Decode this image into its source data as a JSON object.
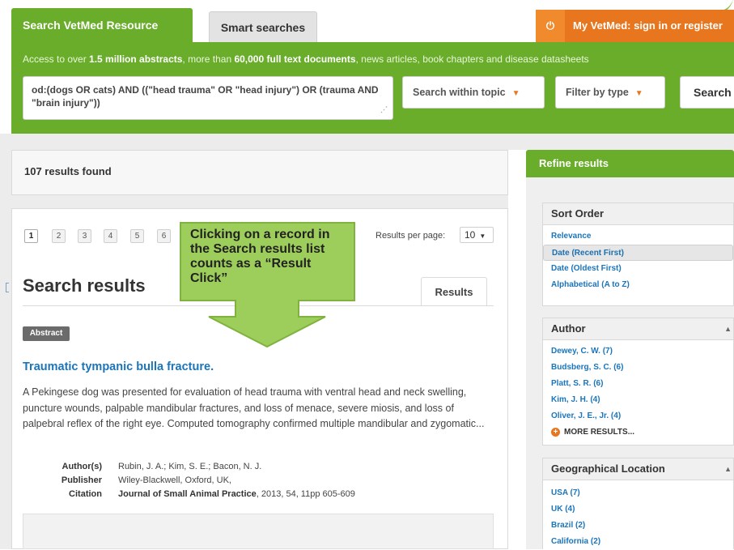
{
  "header": {
    "tab_active": "Search VetMed Resource",
    "tab_inactive": "Smart searches",
    "myvetmed": "My VetMed: sign in or register",
    "access_parts": [
      "Access to over ",
      "1.5 million abstracts",
      ", more than ",
      "60,000 full text documents",
      ", news articles, book chapters and disease datasheets"
    ],
    "query_value": "od:(dogs OR cats) AND ((\"head trauma\" OR \"head injury\") OR (trauma AND \"brain injury\"))",
    "topic_select": "Search within topic",
    "type_select": "Filter by type",
    "search_button": "Search"
  },
  "results": {
    "count_text": "107 results found",
    "pages": [
      "1",
      "2",
      "3",
      "4",
      "5",
      "6"
    ],
    "rpp_label": "Results per page:",
    "rpp_value": "10",
    "heading": "Search results",
    "tab": "Results",
    "items": [
      {
        "badge": "Abstract",
        "title": "Traumatic tympanic bulla fracture.",
        "snippet": "A Pekingese dog was presented for evaluation of head trauma with ventral head and neck swelling, puncture wounds, palpable mandibular fractures, and loss of menace, severe miosis, and loss of palpebral reflex of the right eye. Computed tomography confirmed multiple mandibular and zygomatic...",
        "authors_label": "Author(s)",
        "authors": "Rubin, J. A.; Kim, S. E.; Bacon, N. J.",
        "publisher_label": "Publisher",
        "publisher": "Wiley-Blackwell, Oxford, UK,",
        "citation_label": "Citation",
        "citation_journal": "Journal of Small Animal Practice",
        "citation_rest": ", 2013, 54, 11pp 605-609"
      }
    ]
  },
  "callout": {
    "text": "Clicking on a record in the Search results list counts  as a “Result Click”",
    "color": "#9dce5b"
  },
  "refine": {
    "title": "Refine results",
    "sort_order": {
      "title": "Sort Order",
      "items": [
        "Relevance",
        "Date (Recent First)",
        "Date (Oldest First)",
        "Alphabetical (A to Z)"
      ],
      "selected": "Date (Recent First)"
    },
    "author": {
      "title": "Author",
      "items": [
        "Dewey, C. W. (7)",
        "Budsberg, S. C. (6)",
        "Platt, S. R. (6)",
        "Kim, J. H. (4)",
        "Oliver, J. E., Jr. (4)"
      ],
      "more": "MORE RESULTS..."
    },
    "geo": {
      "title": "Geographical Location",
      "items": [
        "USA (7)",
        "UK (4)",
        "Brazil (2)",
        "California (2)"
      ]
    }
  },
  "colors": {
    "brand_green": "#69ad2b",
    "accent_orange": "#e8761e",
    "link_blue": "#1a75bb"
  },
  "icons": {
    "myvetmed": "power-icon",
    "select_caret": "chevron-down-icon",
    "more": "plus-circle-icon"
  }
}
